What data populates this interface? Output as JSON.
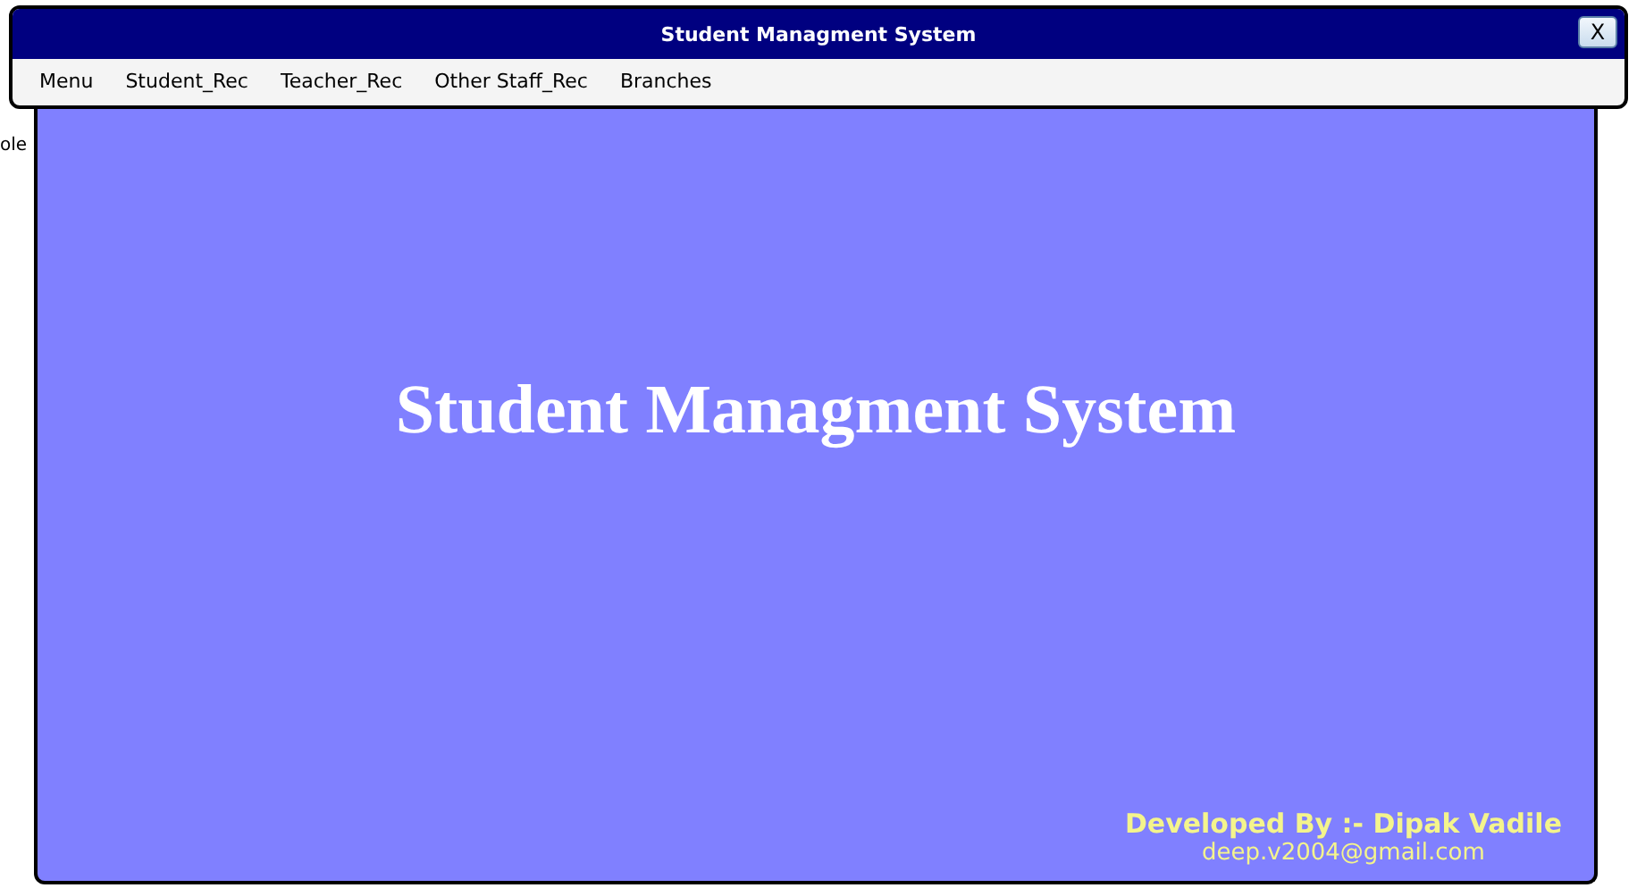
{
  "background_text": "ole",
  "window": {
    "title": "Student Managment System",
    "close_button": "X"
  },
  "menu": [
    {
      "label": "Menu"
    },
    {
      "label": "Student_Rec"
    },
    {
      "label": "Teacher_Rec"
    },
    {
      "label": "Other Staff_Rec"
    },
    {
      "label": "Branches"
    }
  ],
  "main": {
    "heading": "Student Managment System",
    "credit": "Developed By :- Dipak Vadile",
    "email": "deep.v2004@gmail.com"
  }
}
